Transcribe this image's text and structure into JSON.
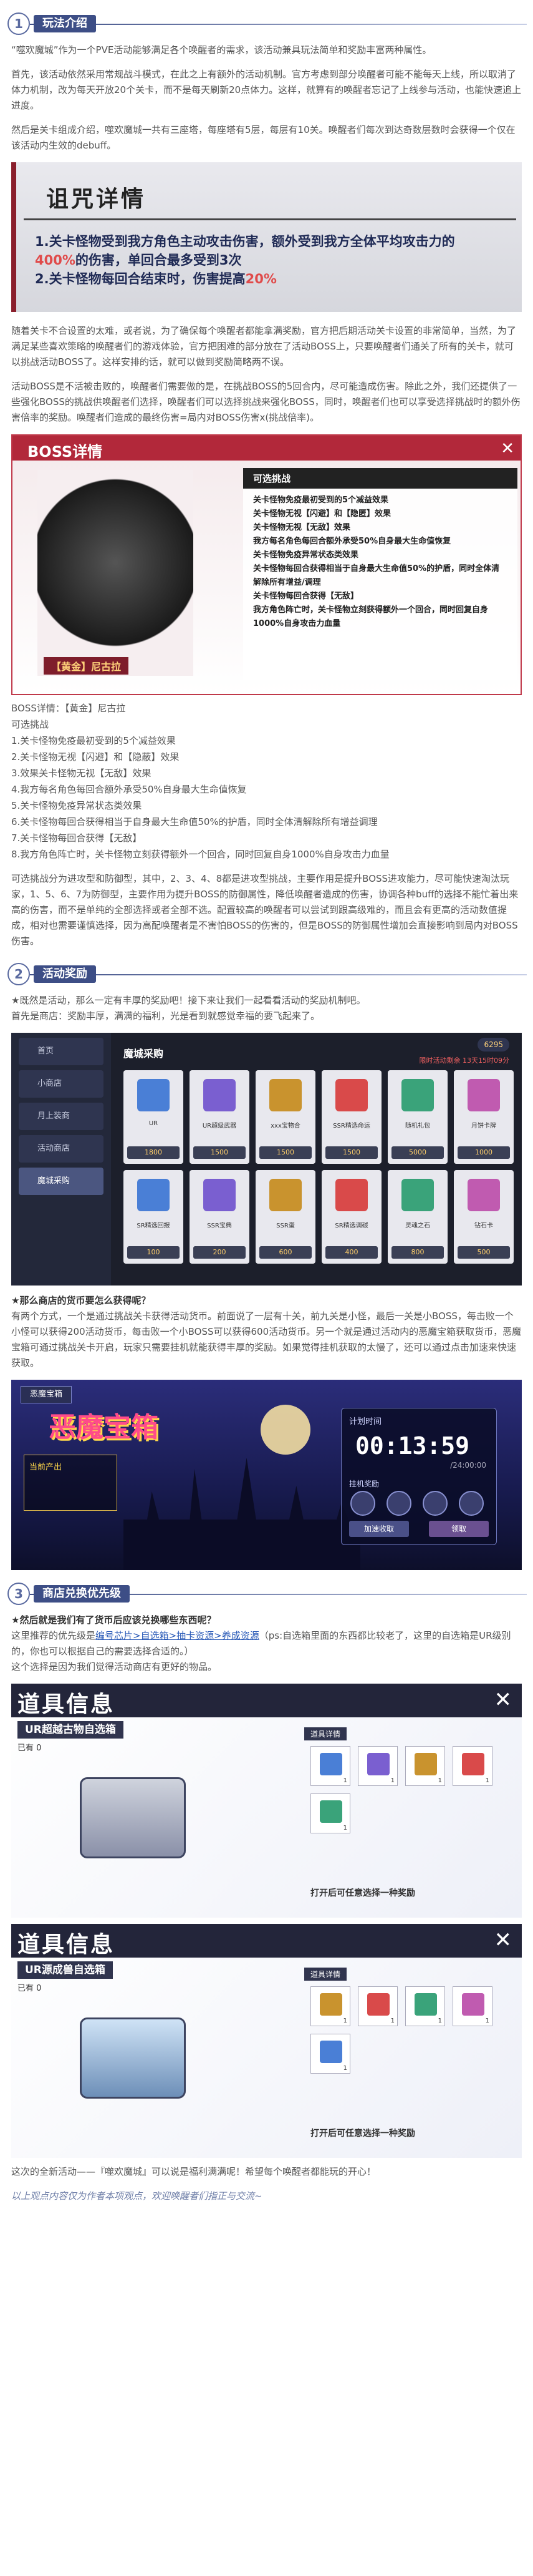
{
  "s1": {
    "num": "1",
    "title": "玩法介绍",
    "p1": "“噬欢魔城”作为一个PVE活动能够满足各个唤醒者的需求，该活动兼具玩法简单和奖励丰富两种属性。",
    "p2": "首先，该活动依然采用常规战斗模式，在此之上有额外的活动机制。官方考虑到部分唤醒者可能不能每天上线，所以取消了体力机制，改为每天开放20个关卡，而不是每天刷新20点体力。这样，就算有的唤醒者忘记了上线参与活动，也能快速追上进度。",
    "p3": "然后是关卡组成介绍，噬欢魔城一共有三座塔，每座塔有5层，每层有10关。唤醒者们每次到达奇数层数时会获得一个仅在该活动内生效的debuff。",
    "curse_title": "诅咒详情",
    "curse_1a": "1.关卡怪物受到我方角色主动攻击伤害，额外受到我方全体平均攻击力的",
    "curse_1b": "400%",
    "curse_1c": "的伤害，单回合最多受到3次",
    "curse_2a": "2.关卡怪物每回合结束时，伤害提高",
    "curse_2b": "20%",
    "p4": "随着关卡不合设置的太难，或者说，为了确保每个唤醒者都能拿满奖励，官方把后期活动关卡设置的非常简单，当然，为了满足某些喜欢策略的唤醒者们的游戏体验，官方把困难的部分放在了活动BOSS上，只要唤醒者们通关了所有的关卡，就可以挑战活动BOSS了。这样安排的话，就可以做到奖励简略两不误。",
    "p5": "活动BOSS是不活被击败的，唤醒者们需要做的是，在挑战BOSS的5回合内，尽可能造成伤害。除此之外，我们还提供了一些强化BOSS的挑战供唤醒者们选择，唤醒者们可以选择挑战来强化BOSS，同时，唤醒者们也可以享受选择挑战时的额外伤害倍率的奖励。唤醒者们造成的最终伤害=局内对BOSS伤害x(挑战倍率)。",
    "boss": {
      "title": "BOSS详情",
      "name": "【黄金】尼古拉",
      "panel": "可选挑战",
      "rows": [
        "关卡怪物免疫最初受到的5个减益效果",
        "关卡怪物无视【闪避】和【隐匿】效果",
        "关卡怪物无视【无敌】效果",
        "我方每名角色每回合额外承受50%自身最大生命值恢复",
        "关卡怪物免疫异常状态类效果",
        "关卡怪物每回合获得相当于自身最大生命值50%的护盾，同时全体清解除所有增益/调理",
        "关卡怪物每回合获得【无敌】",
        "我方角色阵亡时，关卡怪物立刻获得额外一个回合，同时回复自身1000%自身攻击力血量"
      ]
    },
    "list_title": "BOSS详情：【黄金】尼古拉",
    "list_sub": "可选挑战",
    "list": [
      "1.关卡怪物免疫最初受到的5个减益效果",
      "2.关卡怪物无视【闪避】和【隐蔽】效果",
      "3.效果关卡怪物无视【无敌】效果",
      "4.我方每名角色每回合额外承受50%自身最大生命值恢复",
      "5.关卡怪物免疫异常状态类效果",
      "6.关卡怪物每回合获得相当于自身最大生命值50%的护盾，同时全体清解除所有增益调理",
      "7.关卡怪物每回合获得【无敌】",
      "8.我方角色阵亡时，关卡怪物立刻获得额外一个回合，同时回复自身1000%自身攻击力血量"
    ],
    "p6": "可选挑战分为进攻型和防御型，其中，2、3、4、8都是进攻型挑战，主要作用是提升BOSS进攻能力，尽可能快速淘汰玩家，1、5、6、7为防御型，主要作用为提升BOSS的防御属性，降低唤醒者造成的伤害，协调各种buff的选择不能忙着出来高的伤害，而不是单纯的全部选择或者全部不选。配置较高的唤醒者可以尝试到跟高级难的，而且会有更高的活动数值提成，相对也需要谨慎选择，因为高配唤醒者是不害怕BOSS的伤害的，但是BOSS的防御属性增加会直接影响到局内对BOSS伤害。"
  },
  "s2": {
    "num": "2",
    "title": "活动奖励",
    "q1": "★既然是活动，那么一定有丰厚的奖励吧！接下来让我们一起看看活动的奖励机制吧。",
    "q2": "首先是商店：奖励丰厚，满满的福利，光是看到就感觉幸福的要飞起来了。",
    "shop": {
      "menu": [
        "首页",
        "小商店",
        "月上装商",
        "活动商店",
        "魔城采购"
      ],
      "header": "魔城采购",
      "currency": "6295",
      "notice": "限时活动剩余 13天15时09分",
      "items": [
        {
          "n": "UR",
          "p": "1800"
        },
        {
          "n": "UR超级武器",
          "p": "1500"
        },
        {
          "n": "xxx宝物合",
          "p": "1500"
        },
        {
          "n": "SSR精选命运",
          "p": "1500"
        },
        {
          "n": "随机礼包",
          "p": "5000"
        },
        {
          "n": "月饼卡牌",
          "p": "1000"
        },
        {
          "n": "SR精选回报",
          "p": "100"
        },
        {
          "n": "SSR宝典",
          "p": "200"
        },
        {
          "n": "SSR蛋",
          "p": "600"
        },
        {
          "n": "SR精选调碳",
          "p": "400"
        },
        {
          "n": "灵魂之石",
          "p": "800"
        },
        {
          "n": "钻石卡",
          "p": "500"
        }
      ]
    },
    "q3": "★那么商店的货币要怎么获得呢？",
    "q4": "有两个方式，一个是通过挑战关卡获得活动货币。前面说了一层有十关，前九关是小怪，最后一关是小BOSS，每击败一个小怪可以获得200活动货币，每击败一个小BOSS可以获得600活动货币。另一个就是通过活动内的恶魔宝箱获取货币，恶魔宝箱可通过挑战关卡开启，玩家只需要挂机就能获得丰厚的奖励。如果觉得挂机获取的太慢了，还可以通过点击加速来快速获取。",
    "cast": {
      "back": "恶魔宝箱",
      "logo": "恶魔宝箱",
      "gold": "当前产出",
      "t1": "计划时间",
      "time": "00:13:59",
      "t3": "/24:00:00",
      "t4": "挂机奖励",
      "b1": "加速收取",
      "b2": "领取"
    }
  },
  "s3": {
    "num": "3",
    "title": "商店兑换优先级",
    "q1": "★然后就是我们有了货币后应该兑换哪些东西呢？",
    "q2a": "这里推荐的优先级是",
    "q2b": "编号芯片>自选箱>抽卡资源>养成资源",
    "q2c": "（ps:自选箱里面的东西都比较老了，这里的自选箱是UR级别的，你也可以根据自己的需要选择合适的。）",
    "q3": "这个选择是因为我们觉得活动商店有更好的物品。",
    "item1": {
      "title": "道具信息",
      "name": "UR超越古物自选箱",
      "own": "已有 0",
      "det": "道具详情",
      "cap": "打开后可任意选择一种奖励",
      "slots": [
        "1",
        "1",
        "1",
        "1",
        "1"
      ]
    },
    "item2": {
      "title": "道具信息",
      "name": "UR源成兽自选箱",
      "own": "已有 0",
      "det": "道具详情",
      "cap": "打开后可任意选择一种奖励",
      "slots": [
        "1",
        "1",
        "1",
        "1",
        "1"
      ]
    },
    "end": "这次的全新活动——『噬欢魔城』可以说是福利满满呢！希望每个唤醒者都能玩的开心！",
    "foot": "以上观点内容仅为作者本项观点，欢迎唤醒者们指正与交流~"
  }
}
